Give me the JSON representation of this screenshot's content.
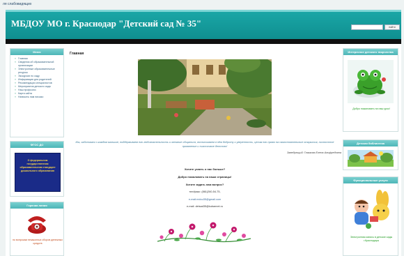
{
  "top_link": "ля слабовидящих",
  "header": {
    "title": "МБДОУ МО г. Краснодар \"Детский сад № 35\"",
    "search_placeholder": "",
    "search_button": "найти"
  },
  "sidebar_left": {
    "menu_title": "Меню",
    "menu_items": [
      "Главная",
      "Сведения об образовательной организации",
      "Электронные образовательные ресурсы",
      "Экскурсии по саду",
      "Информация для родителей",
      "Рекомендации специалистов",
      "Мероприятия детского сада",
      "Наш профсоюз",
      "Карта сайта",
      "Написать нам письмо"
    ],
    "fgos_title": "ФГОС ДО",
    "fgos_text": "О федеральном государственном образовательном стандарте дошкольного образования",
    "hotline_title": "Горячая линия",
    "hotline_caption": "по вопросам незаконных сборов денежных средств"
  },
  "main": {
    "page_title": "Главная",
    "quote": "Мы, заботимся о каждом малыше, поддерживаем его любознательность и желание общаться, воспитываем в нём доброту и уверенность, ценим его право на самостоятельные открытия, личностное проявление и счастливое детство!",
    "director": "Заведующий: Глазкова Елена Альфредовна",
    "contacts": {
      "want_more": "Хотите узнать о нас больше?",
      "welcome": "Добро пожаловать на наши страницы!",
      "ask": "Хотите задать нам вопрос?",
      "phone": "тел/факс: (861)260-54-75,",
      "email1": "e-mail:mdou35@gmail.com",
      "email2": "e-mail: detsad35@kubannet.ru"
    }
  },
  "sidebar_right": {
    "games_title": "Интересное детского творчества",
    "games_caption": "Добро пожаловать на наш урок!",
    "library_title": "Детская библиотека",
    "service_title": "Функциональные услуги",
    "service_caption": "Электронная запись в детские сады г.Краснодара"
  },
  "colors": {
    "header": "#12999a",
    "block_header": "#5cc0c2",
    "menu_link": "#2f5f7f"
  }
}
